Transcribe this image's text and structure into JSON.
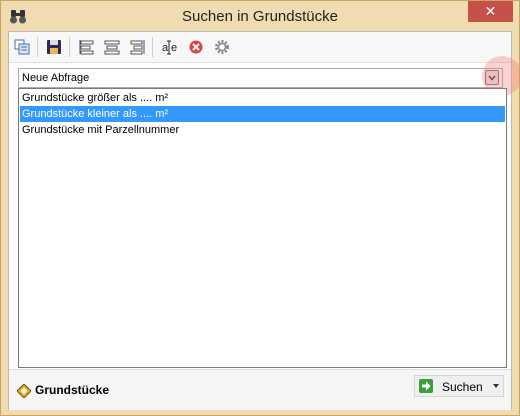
{
  "window": {
    "title": "Suchen in Grundstücke",
    "close_label": "✕"
  },
  "toolbar": {
    "items": [
      {
        "name": "copy-layer-icon"
      },
      {
        "name": "save-icon"
      },
      {
        "name": "align-left-icon"
      },
      {
        "name": "align-center-icon"
      },
      {
        "name": "align-right-icon"
      },
      {
        "name": "text-field-icon"
      },
      {
        "name": "delete-icon"
      },
      {
        "name": "settings-icon"
      }
    ]
  },
  "query": {
    "selected_label": "Neue Abfrage",
    "options": [
      "Grundstücke größer als .... m²",
      "Grundstücke kleiner als .... m²",
      "Grundstücke mit Parzellnummer"
    ],
    "highlighted_index": 1
  },
  "footer": {
    "layer_label": "Grundstücke",
    "search_label": "Suchen"
  },
  "colors": {
    "window_frame": "#f0dcb0",
    "close_button": "#c7514a",
    "selection": "#3399ff"
  }
}
